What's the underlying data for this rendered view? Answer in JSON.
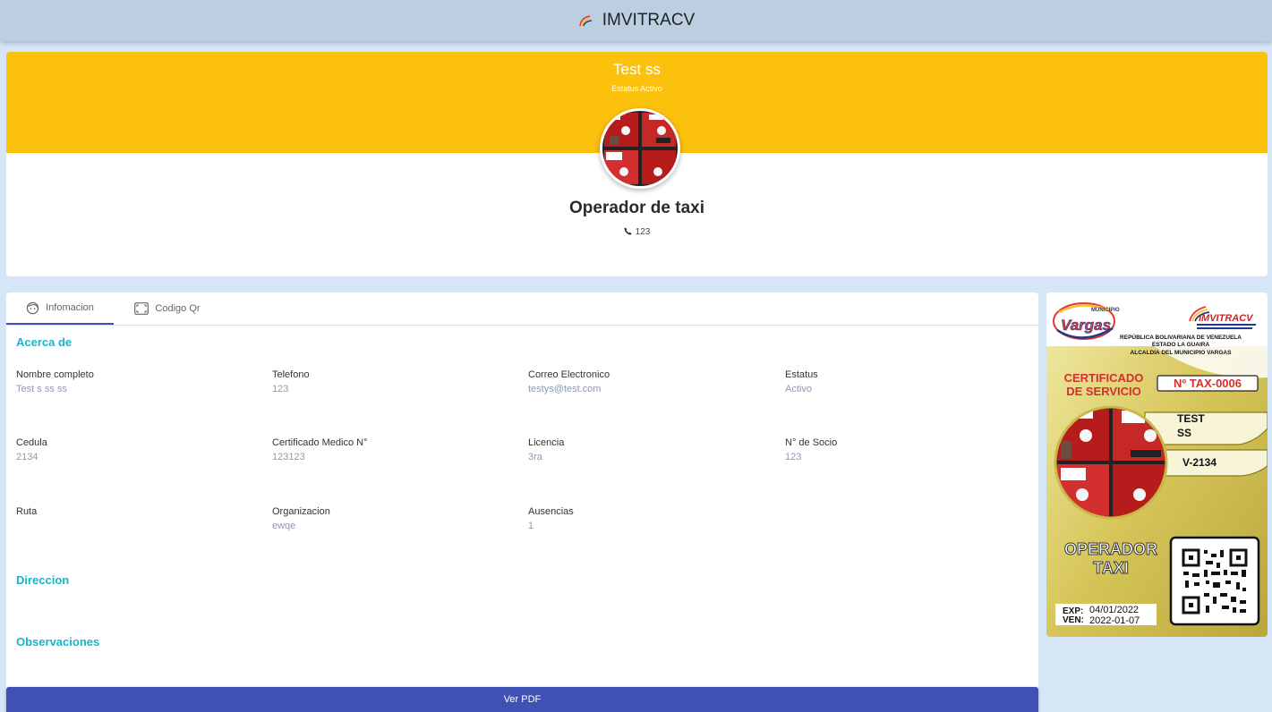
{
  "app": {
    "title": "IMVITRACV"
  },
  "profile": {
    "name": "Test ss",
    "status": "Estatus Activo",
    "role": "Operador de taxi",
    "phone": "123"
  },
  "tabs": [
    {
      "label": "Infomacion",
      "icon": "face-icon",
      "active": true
    },
    {
      "label": "Codigo Qr",
      "icon": "qr-scan-icon",
      "active": false
    }
  ],
  "sections": {
    "about": "Acerca de",
    "address": "Direccion",
    "observations": "Observaciones"
  },
  "fields": [
    {
      "label": "Nombre completo",
      "value": "Test s ss ss"
    },
    {
      "label": "Telefono",
      "value": "123"
    },
    {
      "label": "Correo Electronico",
      "value": "testys@test.com"
    },
    {
      "label": "Estatus",
      "value": "Activo"
    },
    {
      "label": "Cedula",
      "value": "2134"
    },
    {
      "label": "Certificado Medico N°",
      "value": "123123"
    },
    {
      "label": "Licencia",
      "value": "3ra"
    },
    {
      "label": "N° de Socio",
      "value": "123"
    },
    {
      "label": "Ruta",
      "value": ""
    },
    {
      "label": "Organizacion",
      "value": "ewqe"
    },
    {
      "label": "Ausencias",
      "value": "1"
    }
  ],
  "actions": {
    "pdf_button": "Ver PDF"
  },
  "certificate": {
    "municipio_logo_top": "MUNICIPIO",
    "municipio_logo_name": "Vargas",
    "agency_logo": "IMVITRACV",
    "header_line1": "REPÚBLICA BOLIVARIANA DE VENEZUELA",
    "header_line2": "ESTADO LA GUAIRA",
    "header_line3": "ALCALDIA DEL MUNICIPIO VARGAS",
    "cert_title_line1": "CERTIFICADO",
    "cert_title_line2": "DE SERVICIO",
    "number": "Nº TAX-0006",
    "holder_line1": "TEST",
    "holder_line2": "SS",
    "id": "V-2134",
    "role_line1": "OPERADOR",
    "role_line2": "TAXI",
    "exp_label": "EXP:",
    "exp_date": "04/01/2022",
    "ven_label": "VEN:",
    "ven_date": "2022-01-07"
  },
  "colors": {
    "topbar": "#bccfe0",
    "banner": "#fcc10c",
    "section_title": "#17b5cc",
    "primary": "#3f51b5",
    "page_bg": "#d6e6f6"
  }
}
